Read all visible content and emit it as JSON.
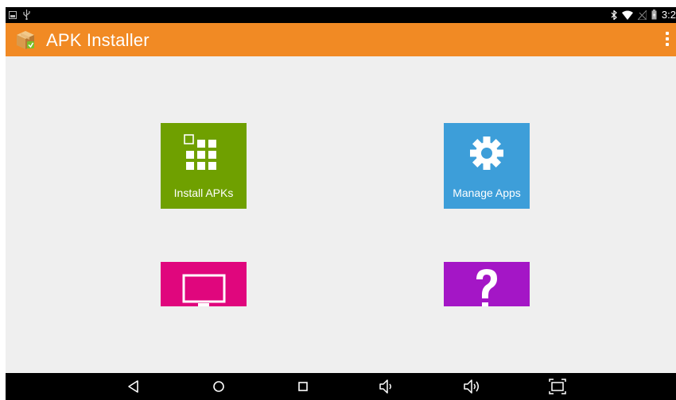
{
  "colors": {
    "accent": "#f18a24",
    "install_tile": "#6fa000",
    "manage_tile": "#3d9ed9",
    "tv_tile": "#e0067d",
    "help_tile": "#a416c6"
  },
  "status_bar": {
    "time": "3:2",
    "icons": [
      "screenshot-icon",
      "usb-icon",
      "bluetooth-icon",
      "wifi-icon",
      "no-sim-icon",
      "battery-icon"
    ]
  },
  "app_bar": {
    "title": "APK Installer",
    "logo": "package-box-icon",
    "menu": "overflow-menu-icon"
  },
  "tiles": [
    {
      "label": "Install APKs",
      "icon": "grid-icon"
    },
    {
      "label": "Manage Apps",
      "icon": "gear-icon"
    },
    {
      "label": "",
      "icon": "tv-icon"
    },
    {
      "label": "",
      "icon": "question-icon"
    }
  ],
  "nav_bar": {
    "buttons": [
      "back-icon",
      "home-icon",
      "recents-icon",
      "volume-down-icon",
      "volume-up-icon",
      "screenshot-icon"
    ]
  }
}
